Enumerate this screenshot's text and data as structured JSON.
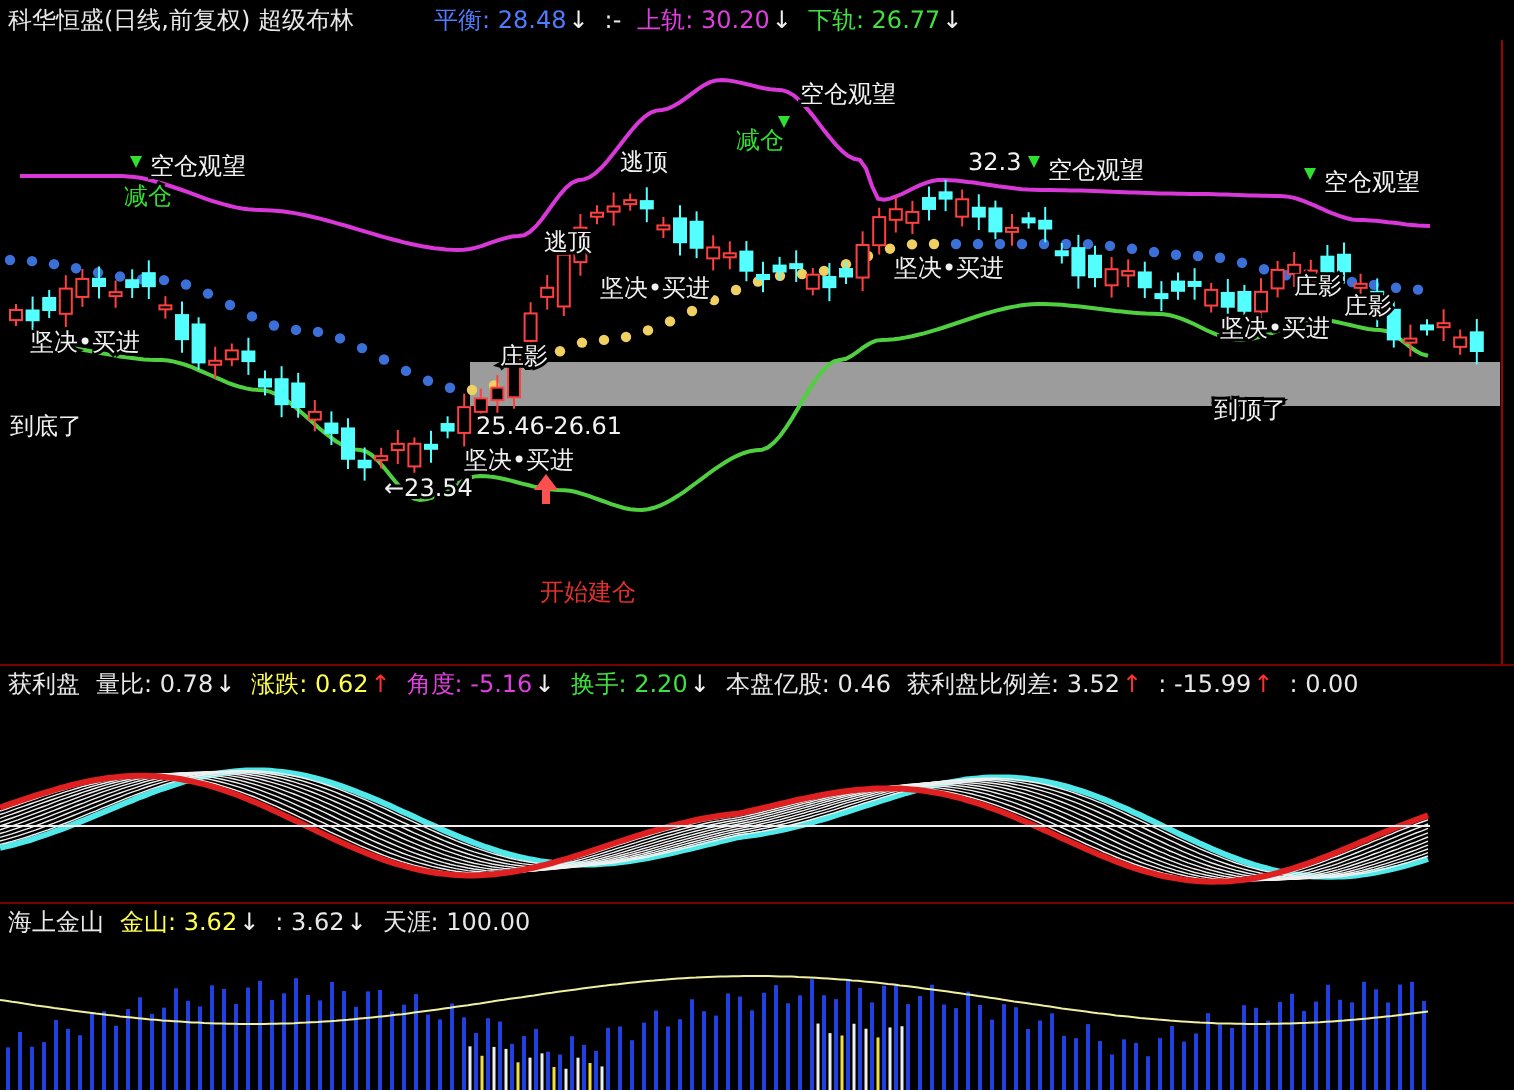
{
  "header": {
    "title": "科华恒盛(日线,前复权) 超级布林",
    "readouts": [
      {
        "text": "平衡: 28.48",
        "arrow": "↓",
        "rising": false,
        "color": "#4f7cff"
      },
      {
        "text": ":-",
        "color": "#e8e8e8"
      },
      {
        "text": "上轨: 30.20",
        "arrow": "↓",
        "rising": false,
        "color": "#e040e0"
      },
      {
        "text": "下轨: 26.77",
        "arrow": "↓",
        "rising": false,
        "color": "#40e040"
      }
    ]
  },
  "main_chart": {
    "annotations": [
      {
        "text": "空仓观望",
        "kind": "signal"
      },
      {
        "text": "减仓",
        "kind": "alert"
      },
      {
        "text": "减仓",
        "kind": "alert"
      },
      {
        "text": "空仓观望",
        "kind": "signal"
      },
      {
        "text": "逃顶",
        "kind": "signal"
      },
      {
        "text": "32.3",
        "kind": "price"
      },
      {
        "text": "空仓观望",
        "kind": "signal"
      },
      {
        "text": "空仓观望",
        "kind": "signal"
      },
      {
        "text": "逃顶",
        "kind": "signal"
      },
      {
        "text": "坚决•买进",
        "kind": "signal"
      },
      {
        "text": "坚决•买进",
        "kind": "signal"
      },
      {
        "text": "庄影",
        "kind": "signal"
      },
      {
        "text": "庄影",
        "kind": "signal"
      },
      {
        "text": "坚决•买进",
        "kind": "signal"
      },
      {
        "text": "坚决•买进",
        "kind": "signal"
      },
      {
        "text": "庄影",
        "kind": "signal"
      },
      {
        "text": "到底了",
        "kind": "signal"
      },
      {
        "text": "到顶了",
        "kind": "signal"
      },
      {
        "text": "25.46-26.61",
        "kind": "price"
      },
      {
        "text": "坚决•买进",
        "kind": "signal"
      },
      {
        "text": "←23.54",
        "kind": "price"
      },
      {
        "text": "开始建仓",
        "kind": "warning"
      }
    ]
  },
  "panels": [
    {
      "title": "获利盘",
      "readouts": [
        {
          "text": "量比: 0.78",
          "arrow": "↓",
          "rising": false,
          "color": "#e8e8e8"
        },
        {
          "text": "涨跌: 0.62",
          "arrow": "↑",
          "rising": true,
          "color": "#ffff50"
        },
        {
          "text": "角度: -5.16",
          "arrow": "↓",
          "rising": false,
          "color": "#e040e0"
        },
        {
          "text": "换手: 2.20",
          "arrow": "↓",
          "rising": false,
          "color": "#40e040"
        },
        {
          "text": "本盘亿股: 0.46",
          "color": "#e8e8e8"
        },
        {
          "text": "获利盘比例差: 3.52",
          "arrow": "↑",
          "rising": true,
          "color": "#e8e8e8"
        },
        {
          "text": ": -15.99",
          "arrow": "↑",
          "rising": true,
          "color": "#e8e8e8"
        },
        {
          "text": ": 0.00",
          "color": "#e8e8e8"
        }
      ]
    },
    {
      "title": "海上金山",
      "readouts": [
        {
          "text": "金山: 3.62",
          "arrow": "↓",
          "rising": false,
          "color": "#ffff50"
        },
        {
          "text": ": 3.62",
          "arrow": "↓",
          "rising": false,
          "color": "#e8e8e8"
        },
        {
          "text": "天涯: 100.00",
          "color": "#e8e8e8"
        }
      ]
    }
  ]
}
